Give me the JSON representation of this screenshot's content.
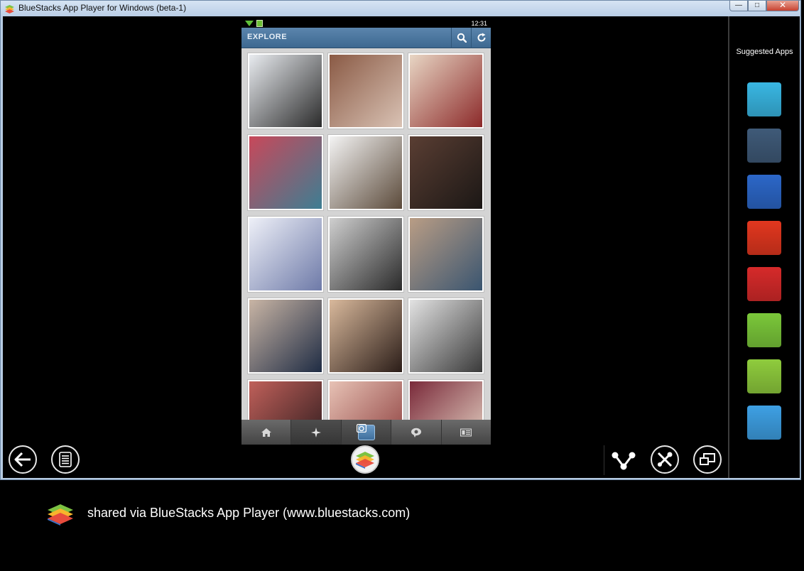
{
  "window": {
    "title": "BlueStacks App Player for Windows (beta-1)",
    "controls": {
      "minimize": "—",
      "maximize": "□",
      "close": "✕"
    }
  },
  "phone": {
    "status_time": "12:31",
    "header_title": "EXPLORE",
    "grid_rows": [
      [
        {
          "name": "photo-youtube-screenshot",
          "c1": "#e9ecf0",
          "c2": "#2b2b2b"
        },
        {
          "name": "photo-collage-girls",
          "c1": "#8a5a45",
          "c2": "#d9c2b4"
        },
        {
          "name": "photo-flag-shorts",
          "c1": "#e8d6c4",
          "c2": "#8c2a2a"
        }
      ],
      [
        {
          "name": "photo-red-caps",
          "c1": "#c8485a",
          "c2": "#3d7e93"
        },
        {
          "name": "photo-milkshakes",
          "c1": "#f4f4f4",
          "c2": "#5b4a3a"
        },
        {
          "name": "photo-portrait-woman",
          "c1": "#5a3e33",
          "c2": "#1b1715"
        }
      ],
      [
        {
          "name": "photo-1000-sek-ad",
          "c1": "#eef0f8",
          "c2": "#6e7aa8"
        },
        {
          "name": "photo-kitten",
          "c1": "#cfcfcf",
          "c2": "#2a2a2a"
        },
        {
          "name": "photo-cowboy-hat",
          "c1": "#b99d85",
          "c2": "#3a5570"
        }
      ],
      [
        {
          "name": "photo-boy-portrait",
          "c1": "#c9b5a5",
          "c2": "#1f2c44"
        },
        {
          "name": "photo-nail-art",
          "c1": "#d9b99c",
          "c2": "#2b1d18"
        },
        {
          "name": "photo-chanel-outfit",
          "c1": "#e3e3e3",
          "c2": "#3a3a3a"
        }
      ],
      [
        {
          "name": "photo-party-girls",
          "c1": "#c0605a",
          "c2": "#2a1a1c"
        },
        {
          "name": "photo-selfie-red-lips",
          "c1": "#e7c2b5",
          "c2": "#8a3a3a"
        },
        {
          "name": "photo-room-decor",
          "c1": "#7a2a3a",
          "c2": "#e8d8c8"
        }
      ]
    ],
    "tabs": [
      "home-icon",
      "explore-icon",
      "camera-icon",
      "activity-icon",
      "profile-icon"
    ]
  },
  "sidebar": {
    "title": "Suggested Apps",
    "apps": [
      {
        "name": "app-bing-maps",
        "color": "#39b7e3"
      },
      {
        "name": "app-tumblr",
        "color": "#3f5a78"
      },
      {
        "name": "app-messenger",
        "color": "#2c67c8"
      },
      {
        "name": "app-badoo",
        "color": "#e2371f"
      },
      {
        "name": "app-raccoon",
        "color": "#d62a2a"
      },
      {
        "name": "app-ubersocial",
        "color": "#7bc83a"
      },
      {
        "name": "app-kik",
        "color": "#8fcc3d"
      },
      {
        "name": "app-twitter-bird",
        "color": "#3ea0e4"
      }
    ]
  },
  "footer": {
    "text": "shared via BlueStacks App Player (www.bluestacks.com)"
  }
}
